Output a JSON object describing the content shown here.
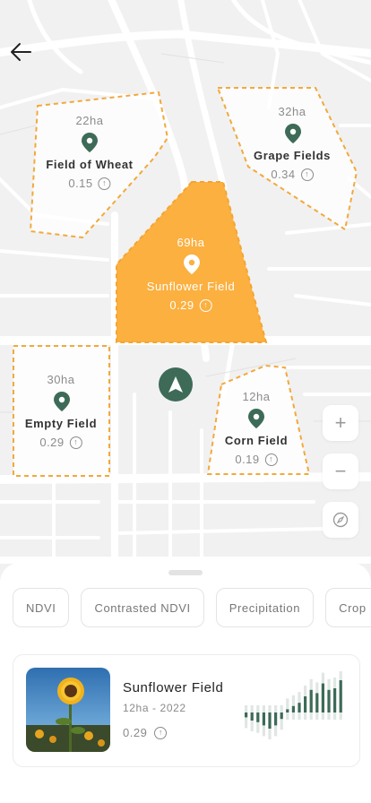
{
  "fields": [
    {
      "id": "wheat",
      "area": "22ha",
      "name": "Field of Wheat",
      "ndvi": "0.15",
      "selected": false
    },
    {
      "id": "grape",
      "area": "32ha",
      "name": "Grape Fields",
      "ndvi": "0.34",
      "selected": false
    },
    {
      "id": "sunflower",
      "area": "69ha",
      "name": "Sunflower Field",
      "ndvi": "0.29",
      "selected": true
    },
    {
      "id": "empty",
      "area": "30ha",
      "name": "Empty Field",
      "ndvi": "0.29",
      "selected": false
    },
    {
      "id": "corn",
      "area": "12ha",
      "name": "Corn Field",
      "ndvi": "0.19",
      "selected": false
    }
  ],
  "icons": {
    "back": "arrow-left-icon",
    "location": "navigation-arrow-icon",
    "zoom_in": "plus-icon",
    "zoom_out": "minus-icon",
    "compass": "compass-icon",
    "pin": "map-pin-icon",
    "trend": "arrow-up-circle-icon"
  },
  "colors": {
    "accent": "#FBB040",
    "pin": "#3D6B57",
    "dash": "#F2A93B",
    "bar_dark": "#3D6B57",
    "bar_light": "#E0E6E3"
  },
  "layers": [
    "NDVI",
    "Contrasted NDVI",
    "Precipitation",
    "Crop"
  ],
  "card": {
    "title": "Sunflower Field",
    "subtitle": "12ha - 2022",
    "value": "0.29",
    "trend_bars": [
      -0.15,
      -0.25,
      -0.3,
      -0.4,
      -0.5,
      -0.4,
      -0.2,
      0.1,
      0.2,
      0.3,
      0.5,
      0.7,
      0.6,
      0.9,
      0.7,
      0.75,
      1.0
    ]
  }
}
